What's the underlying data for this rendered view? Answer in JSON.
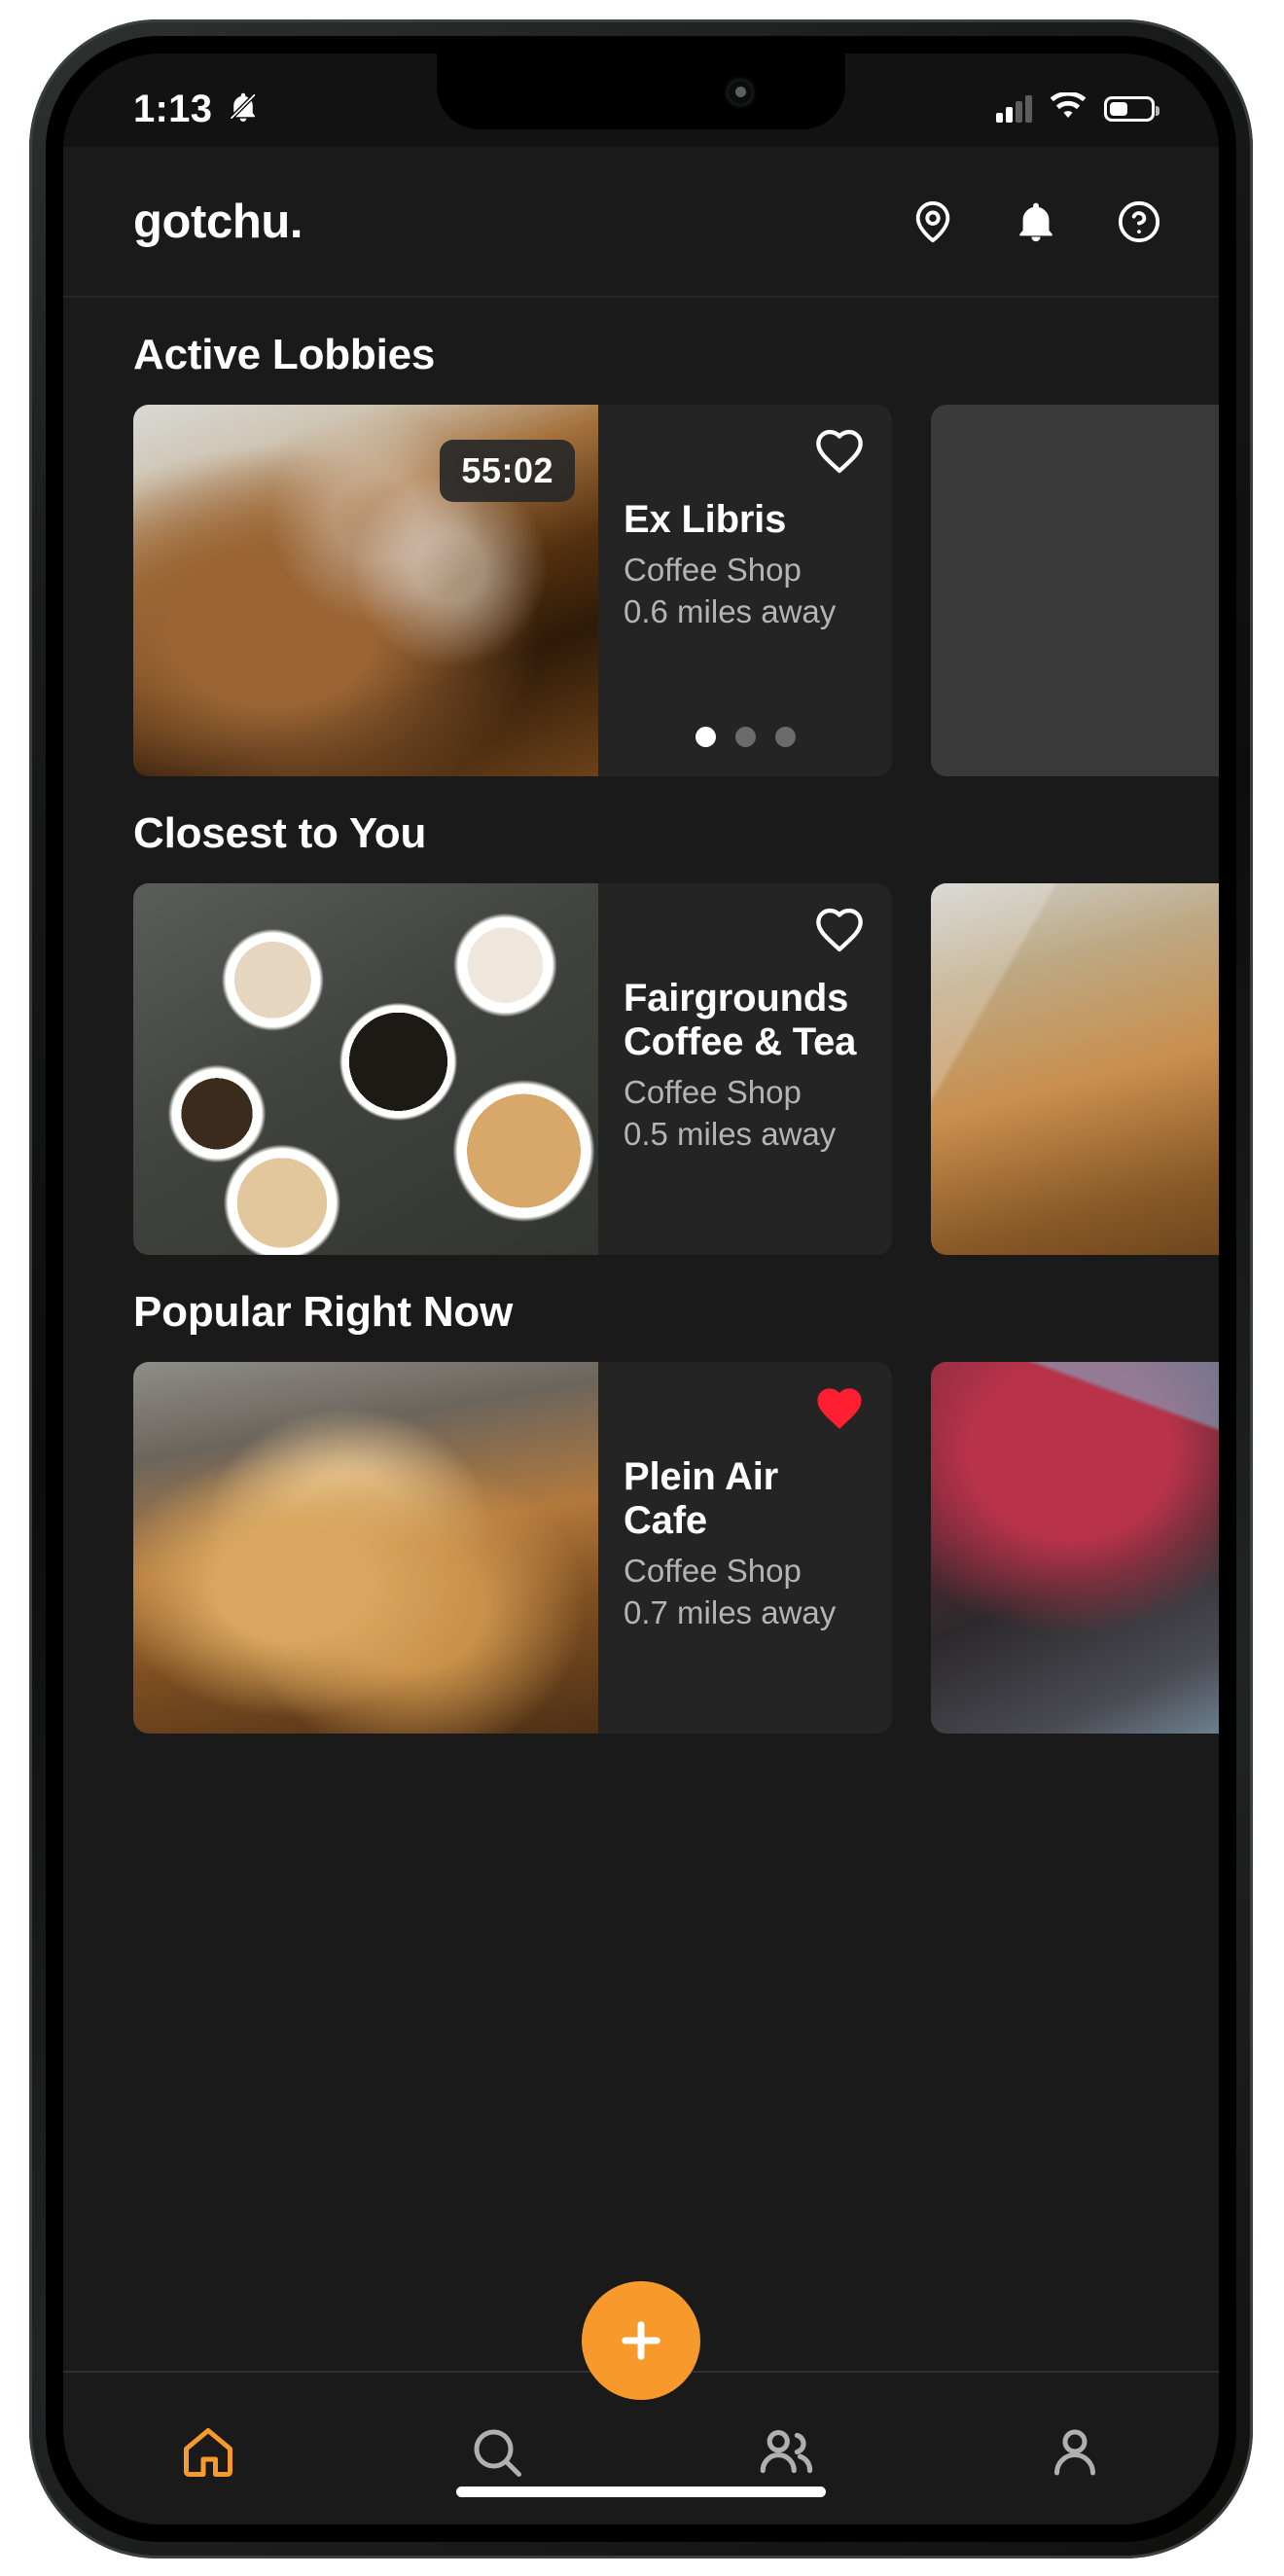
{
  "status_bar": {
    "time": "1:13",
    "silent_icon": "bell-slash-icon",
    "cellular_icon": "cellular-bars-icon",
    "wifi_icon": "wifi-icon",
    "battery_icon": "battery-icon",
    "battery_level_pct": 40
  },
  "header": {
    "title": "gotchu.",
    "actions": [
      {
        "name": "location-pin-icon",
        "label": "Location"
      },
      {
        "name": "bell-icon",
        "label": "Notifications"
      },
      {
        "name": "help-circle-icon",
        "label": "Help"
      }
    ]
  },
  "theme": {
    "background": "#1a1a1a",
    "card_background": "#242424",
    "accent": "#f79a2b",
    "favorite_active": "#ff1f30",
    "text_primary": "#ffffff",
    "text_secondary": "#b4b4b4"
  },
  "sections": [
    {
      "title": "Active Lobbies",
      "cards": [
        {
          "name": "Ex Libris",
          "category": "Coffee Shop",
          "distance": "0.6 miles away",
          "timer": "55:02",
          "favorited": false,
          "photo": "photo-coldbrew",
          "dots": {
            "count": 3,
            "active_index": 0
          }
        },
        {
          "name": "",
          "category": "",
          "distance": "",
          "photo": "photo-placeholder",
          "ghost": true
        }
      ]
    },
    {
      "title": "Closest to You",
      "cards": [
        {
          "name": "Fairgrounds Coffee & Tea",
          "category": "Coffee Shop",
          "distance": "0.5 miles away",
          "favorited": false,
          "photo": "photo-coffeecups"
        },
        {
          "name": "",
          "category": "",
          "distance": "",
          "photo": "photo-woodchair"
        }
      ]
    },
    {
      "title": "Popular Right Now",
      "cards": [
        {
          "name": "Plein Air Cafe",
          "category": "Coffee Shop",
          "distance": "0.7 miles away",
          "favorited": true,
          "photo": "photo-pastry"
        },
        {
          "name": "",
          "category": "",
          "distance": "",
          "photo": "photo-laptop"
        }
      ]
    }
  ],
  "fab": {
    "name": "add-lobby-button",
    "icon": "plus-icon"
  },
  "tab_bar": {
    "items": [
      {
        "name": "tab-home",
        "icon": "home-icon",
        "active": true
      },
      {
        "name": "tab-search",
        "icon": "search-icon",
        "active": false
      },
      {
        "name": "tab-friends",
        "icon": "people-icon",
        "active": false
      },
      {
        "name": "tab-profile",
        "icon": "person-icon",
        "active": false
      }
    ]
  }
}
